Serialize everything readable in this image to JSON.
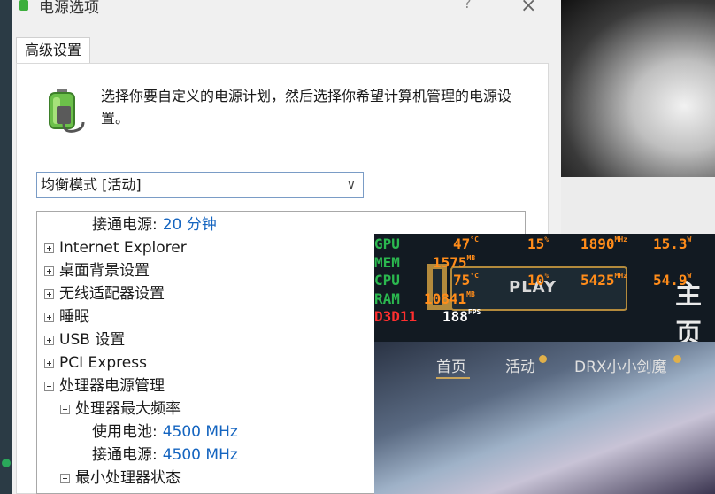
{
  "dialog": {
    "title": "电源选项",
    "help": "?",
    "close": "×",
    "tab": "高级设置",
    "description": "选择你要自定义的电源计划，然后选择你希望计算机管理的电源设置。",
    "plan_value": "均衡模式 [活动]",
    "tree": [
      {
        "text": "接通电源:",
        "value": "20 分钟",
        "indent": 2,
        "expander": "none"
      },
      {
        "text": "Internet Explorer",
        "indent": 0,
        "expander": "plus"
      },
      {
        "text": "桌面背景设置",
        "indent": 0,
        "expander": "plus"
      },
      {
        "text": "无线适配器设置",
        "indent": 0,
        "expander": "plus"
      },
      {
        "text": "睡眠",
        "indent": 0,
        "expander": "plus"
      },
      {
        "text": "USB 设置",
        "indent": 0,
        "expander": "plus"
      },
      {
        "text": "PCI Express",
        "indent": 0,
        "expander": "plus"
      },
      {
        "text": "处理器电源管理",
        "indent": 0,
        "expander": "minus"
      },
      {
        "text": "处理器最大频率",
        "indent": 1,
        "expander": "minus"
      },
      {
        "text": "使用电池:",
        "value": "4500 MHz",
        "indent": 2,
        "expander": "none"
      },
      {
        "text": "接通电源:",
        "value": "4500 MHz",
        "indent": 2,
        "expander": "none"
      },
      {
        "text": "最小处理器状态",
        "indent": 1,
        "expander": "plus"
      }
    ]
  },
  "game": {
    "play_label": "PLAY",
    "header_text": "主页",
    "nav": [
      "首页",
      "活动",
      "DRX小小剑魔"
    ]
  },
  "overlay": {
    "gpu": {
      "label": "GPU",
      "temp": "47",
      "temp_unit": "°C",
      "load": "15",
      "load_unit": "%",
      "clock": "1890",
      "clock_unit": "MHz",
      "power": "15.3",
      "power_unit": "W"
    },
    "mem": {
      "label": "MEM",
      "value": "1575",
      "unit": "MB"
    },
    "cpu": {
      "label": "CPU",
      "temp": "75",
      "temp_unit": "°C",
      "load": "10",
      "load_unit": "%",
      "clock": "5425",
      "clock_unit": "MHz",
      "power": "54.9",
      "power_unit": "W"
    },
    "ram": {
      "label": "RAM",
      "value": "10841",
      "unit": "MB"
    },
    "d3d": {
      "label": "D3D11",
      "fps": "188",
      "fps_unit": "FPS"
    }
  },
  "colors": {
    "link_value": "#1565c0",
    "overlay_label": "#2bb84f",
    "overlay_number": "#ff8c1a",
    "overlay_api": "#ff2f2f"
  }
}
